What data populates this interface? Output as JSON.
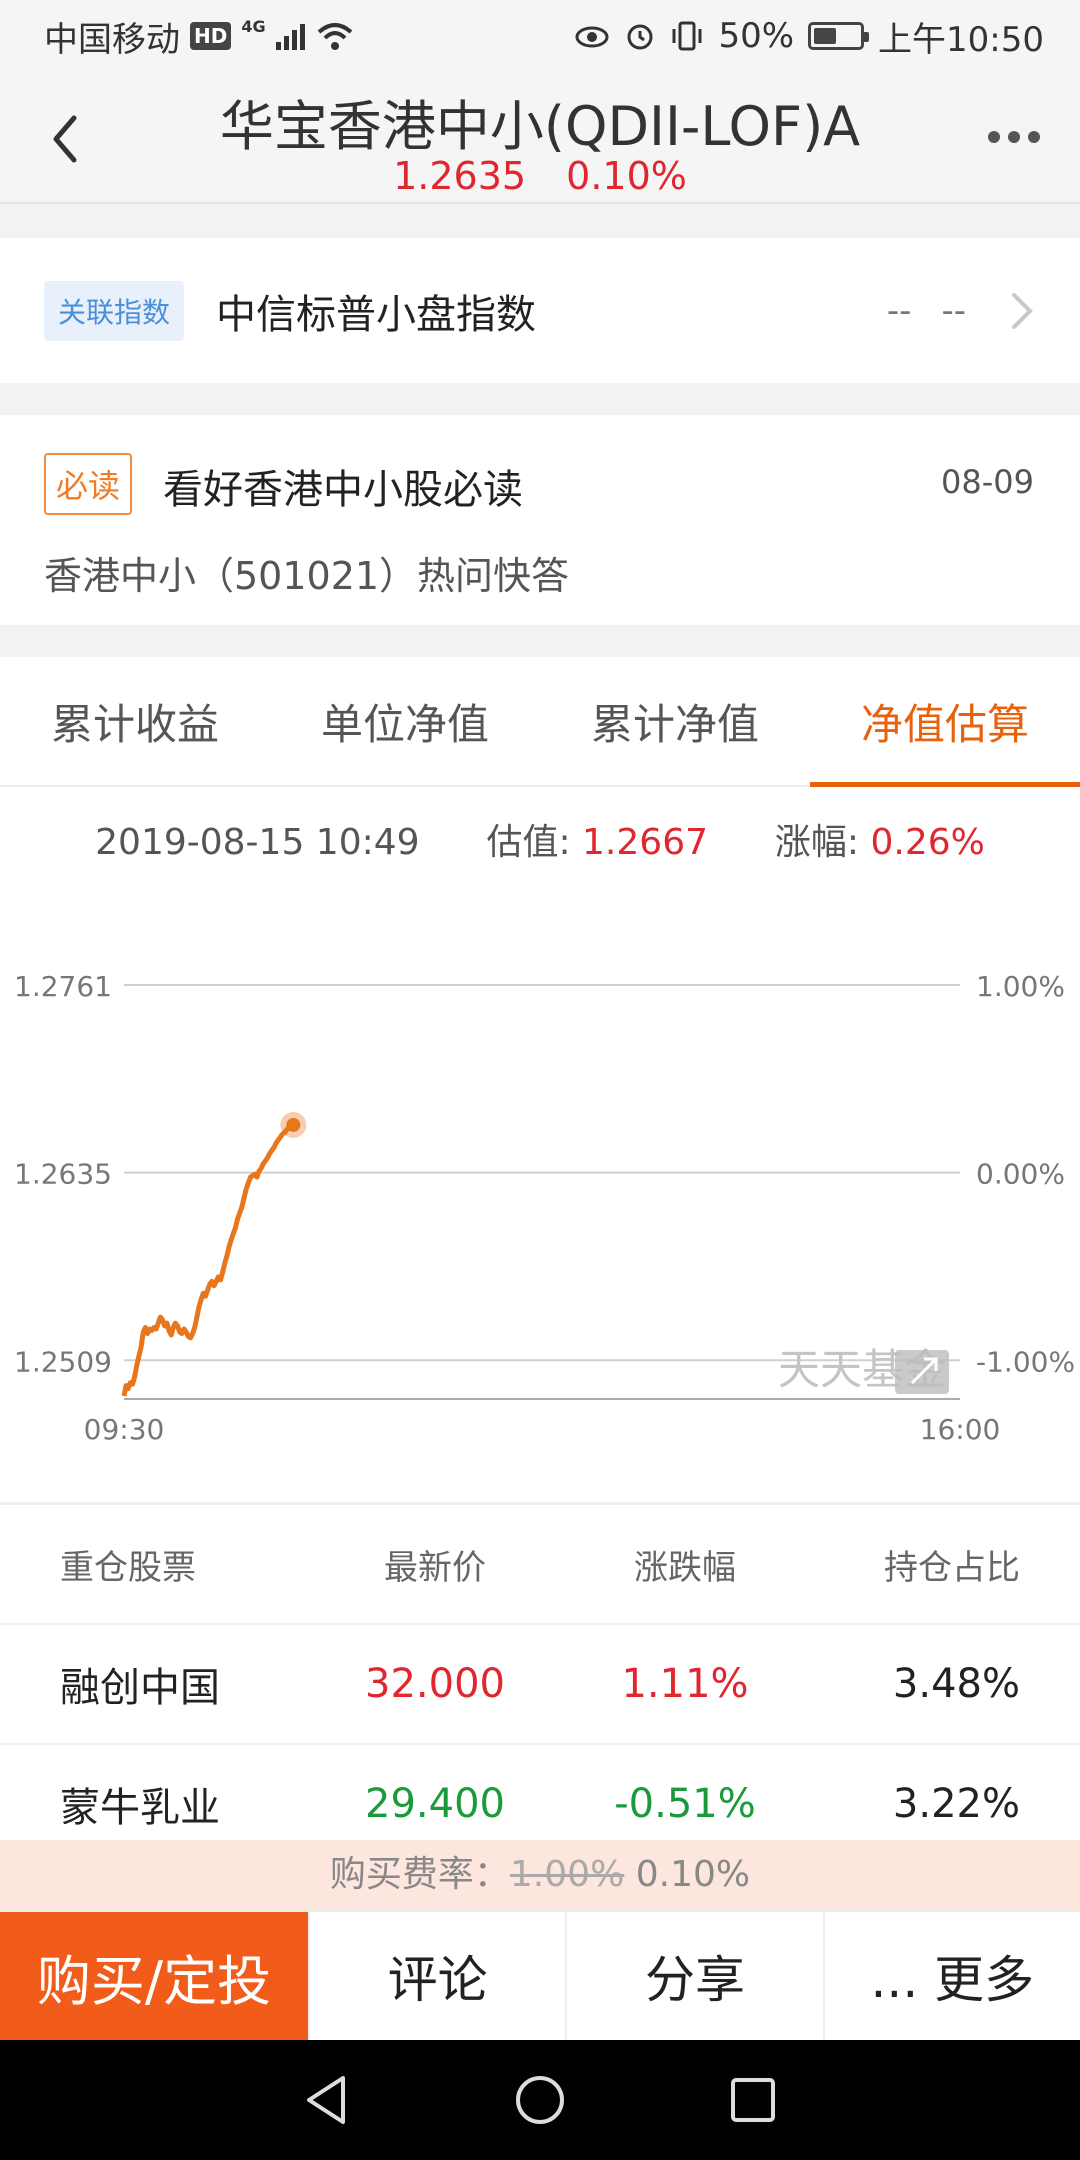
{
  "status_bar": {
    "carrier": "中国移动",
    "hd": "HD",
    "network": "4G",
    "battery": "50%",
    "battery_level": 0.5,
    "time": "上午10:50"
  },
  "header": {
    "title": "华宝香港中小(QDII-LOF)A",
    "nav_value": "1.2635",
    "nav_change": "0.10%"
  },
  "index_card": {
    "tag": "关联指数",
    "name": "中信标普小盘指数",
    "value1": "--",
    "value2": "--"
  },
  "read_card": {
    "tag": "必读",
    "title": "看好香港中小股必读",
    "date": "08-09",
    "subtitle": "香港中小（501021）热问快答"
  },
  "tabs": [
    {
      "label": "累计收益",
      "active": false
    },
    {
      "label": "单位净值",
      "active": false
    },
    {
      "label": "累计净值",
      "active": false
    },
    {
      "label": "净值估算",
      "active": true
    }
  ],
  "chart_header": {
    "datetime": "2019-08-15 10:49",
    "est_label": "估值: ",
    "est_value": "1.2667",
    "chg_label": "涨幅: ",
    "chg_value": "0.26%"
  },
  "watermark": "天天基金",
  "chart_data": {
    "type": "line",
    "y_left_ticks": [
      "1.2761",
      "1.2635",
      "1.2509"
    ],
    "y_right_ticks": [
      "1.00%",
      "0.00%",
      "-1.00%"
    ],
    "x_ticks": [
      "09:30",
      "16:00"
    ],
    "ylim": [
      1.2483,
      1.2761
    ],
    "x_range_minutes": [
      0,
      390
    ],
    "line_color": "#e8761c",
    "series": [
      {
        "x": [
          0,
          1,
          2,
          3,
          4,
          5,
          6,
          7,
          8,
          9,
          10,
          11,
          12,
          13,
          14,
          15,
          16,
          17,
          18,
          19,
          20,
          21,
          22,
          23,
          24,
          25,
          26,
          27,
          28,
          29,
          30,
          31,
          32,
          33,
          34,
          35,
          36,
          37,
          38,
          39,
          40,
          41,
          42,
          43,
          44,
          45,
          46,
          47,
          48,
          49,
          50,
          51,
          52,
          53,
          54,
          55,
          56,
          57,
          58,
          59,
          60,
          61,
          62,
          63,
          64,
          65,
          66,
          67,
          68,
          69,
          70,
          71,
          72,
          73,
          74,
          75,
          76,
          77,
          78,
          79
        ],
        "values": [
          1.2485,
          1.2492,
          1.249,
          1.2494,
          1.2493,
          1.2498,
          1.2506,
          1.2512,
          1.2518,
          1.2528,
          1.2531,
          1.2527,
          1.253,
          1.2529,
          1.2531,
          1.253,
          1.2534,
          1.2538,
          1.2536,
          1.2532,
          1.2534,
          1.2529,
          1.2526,
          1.2531,
          1.2534,
          1.2532,
          1.2528,
          1.2527,
          1.253,
          1.2528,
          1.2525,
          1.2524,
          1.2527,
          1.2531,
          1.2538,
          1.2545,
          1.255,
          1.2554,
          1.2552,
          1.2556,
          1.256,
          1.2562,
          1.2559,
          1.2562,
          1.2565,
          1.2563,
          1.2568,
          1.2574,
          1.2579,
          1.2585,
          1.259,
          1.2594,
          1.2598,
          1.2604,
          1.2608,
          1.2612,
          1.2618,
          1.2624,
          1.2628,
          1.2632,
          1.2633,
          1.2634,
          1.2632,
          1.2636,
          1.2638,
          1.2641,
          1.2643,
          1.2645,
          1.2648,
          1.265,
          1.2652,
          1.2655,
          1.2657,
          1.2659,
          1.2661,
          1.2662,
          1.2664,
          1.2665,
          1.2666,
          1.2667
        ]
      }
    ]
  },
  "holdings": {
    "headers": [
      "重仓股票",
      "最新价",
      "涨跌幅",
      "持仓占比"
    ],
    "rows": [
      {
        "name": "融创中国",
        "price": "32.000",
        "change": "1.11%",
        "weight": "3.48%",
        "dir": "up"
      },
      {
        "name": "蒙牛乳业",
        "price": "29.400",
        "change": "-0.51%",
        "weight": "3.22%",
        "dir": "down"
      }
    ]
  },
  "fee": {
    "label": "购买费率：",
    "original": "1.00%",
    "current": "0.10%"
  },
  "actions": {
    "buy": "购买/定投",
    "comment": "评论",
    "share": "分享",
    "more": "... 更多"
  }
}
